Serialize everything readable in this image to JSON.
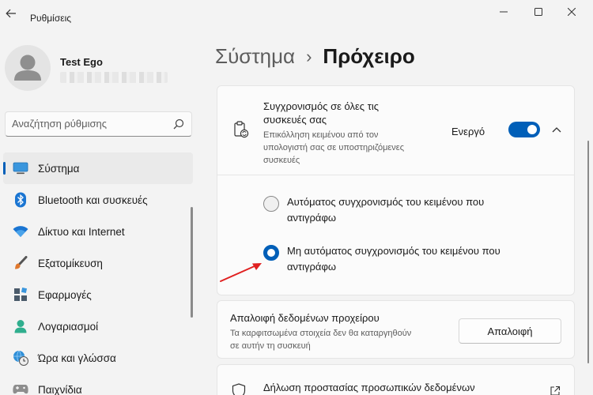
{
  "window": {
    "title": "Ρυθμίσεις"
  },
  "user": {
    "name": "Test Ego"
  },
  "search": {
    "placeholder": "Αναζήτηση ρύθμισης"
  },
  "sidebar": {
    "items": [
      {
        "label": "Σύστημα",
        "icon": "system-icon",
        "active": true
      },
      {
        "label": "Bluetooth και συσκευές",
        "icon": "bluetooth-icon"
      },
      {
        "label": "Δίκτυο και Internet",
        "icon": "wifi-icon"
      },
      {
        "label": "Εξατομίκευση",
        "icon": "brush-icon"
      },
      {
        "label": "Εφαρμογές",
        "icon": "apps-icon"
      },
      {
        "label": "Λογαριασμοί",
        "icon": "account-icon"
      },
      {
        "label": "Ώρα και γλώσσα",
        "icon": "globe-clock-icon"
      },
      {
        "label": "Παιχνίδια",
        "icon": "gamepad-icon"
      }
    ]
  },
  "breadcrumb": {
    "parent": "Σύστημα",
    "separator": "›",
    "current": "Πρόχειρο"
  },
  "sync": {
    "title": "Συγχρονισμός σε όλες τις συσκευές σας",
    "description": "Επικόλληση κειμένου από τον υπολογιστή σας σε υποστηριζόμενες συσκευές",
    "state": "Ενεργό",
    "toggle_on": true,
    "options": [
      {
        "label": "Αυτόματος συγχρονισμός του κειμένου που αντιγράφω",
        "selected": false
      },
      {
        "label": "Μη αυτόματος συγχρονισμός του κειμένου που αντιγράφω",
        "selected": true
      }
    ]
  },
  "clear": {
    "title": "Απαλοιφή δεδομένων προχείρου",
    "description": "Τα καρφιτσωμένα στοιχεία δεν θα καταργηθούν σε αυτήν τη συσκευή",
    "button": "Απαλοιφή"
  },
  "privacy": {
    "title": "Δήλωση προστασίας προσωπικών δεδομένων"
  },
  "colors": {
    "accent": "#005fb8",
    "annotation_arrow": "#e02020"
  }
}
